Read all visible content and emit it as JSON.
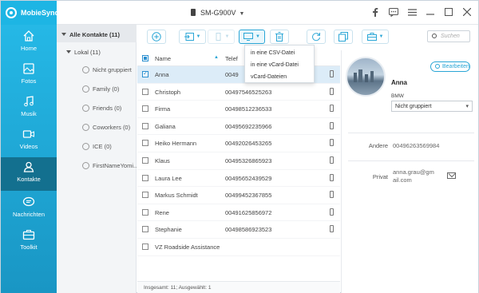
{
  "app": {
    "name": "MobieSync"
  },
  "device": {
    "name": "SM-G900V"
  },
  "window": {
    "icons": [
      "facebook-icon",
      "feedback-icon",
      "menu-icon",
      "minimize-icon",
      "maximize-icon",
      "close-icon"
    ]
  },
  "sidebar": {
    "items": [
      {
        "label": "Home",
        "icon": "home-icon"
      },
      {
        "label": "Fotos",
        "icon": "photo-icon"
      },
      {
        "label": "Musik",
        "icon": "music-icon"
      },
      {
        "label": "Videos",
        "icon": "video-icon"
      },
      {
        "label": "Kontakte",
        "icon": "contacts-icon",
        "active": true
      },
      {
        "label": "Nachrichten",
        "icon": "message-icon"
      },
      {
        "label": "Toolkit",
        "icon": "toolkit-icon"
      }
    ]
  },
  "groups": {
    "all": "Alle Kontakte",
    "all_count": "(11)",
    "local": "Lokal",
    "local_count": "(11)",
    "items": [
      {
        "label": "Nicht gruppiert",
        "count": ""
      },
      {
        "label": "Family",
        "count": "(0)"
      },
      {
        "label": "Friends",
        "count": "(0)"
      },
      {
        "label": "Coworkers",
        "count": "(0)"
      },
      {
        "label": "ICE",
        "count": "(0)"
      },
      {
        "label": "FirstNameYomi...",
        "count": ""
      }
    ]
  },
  "toolbar": {
    "search_placeholder": "Suchen",
    "export_menu": [
      "in eine CSV-Datei",
      "in eine vCard-Datei",
      "vCard-Dateien"
    ]
  },
  "table": {
    "headers": {
      "name": "Name",
      "phone": "Telef"
    },
    "rows": [
      {
        "name": "Anna",
        "phone": "0049",
        "selected": true
      },
      {
        "name": "Christoph",
        "phone": "00497546525263"
      },
      {
        "name": "Firma",
        "phone": "00498512236533"
      },
      {
        "name": "Galiana",
        "phone": "00495692235966"
      },
      {
        "name": "Heiko Hermann",
        "phone": "00492026453265"
      },
      {
        "name": "Klaus",
        "phone": "00495326865923"
      },
      {
        "name": "Laura Lee",
        "phone": "00495652439529"
      },
      {
        "name": "Markus Schmidt",
        "phone": "00499452367855"
      },
      {
        "name": "Rene",
        "phone": "00491625856972"
      },
      {
        "name": "Stephanie",
        "phone": "00498586923523"
      },
      {
        "name": "VZ Roadside Assistance",
        "phone": ""
      }
    ],
    "status": "Insgesamt: 11; Ausgewählt: 1"
  },
  "detail": {
    "edit_label": "Bearbeiten",
    "name": "Anna",
    "company": "BMW",
    "group_select": "Nicht gruppiert",
    "phone_label": "Andere",
    "phone_value": "00496263569984",
    "email_label": "Privat",
    "email_line1": "anna.grau@gm",
    "email_line2": "ail.com"
  },
  "colors": {
    "accent": "#2aa6d6",
    "sidebar": "#1db5e4",
    "sidebar_active": "#13708f",
    "selected_row": "#dcecf8"
  }
}
